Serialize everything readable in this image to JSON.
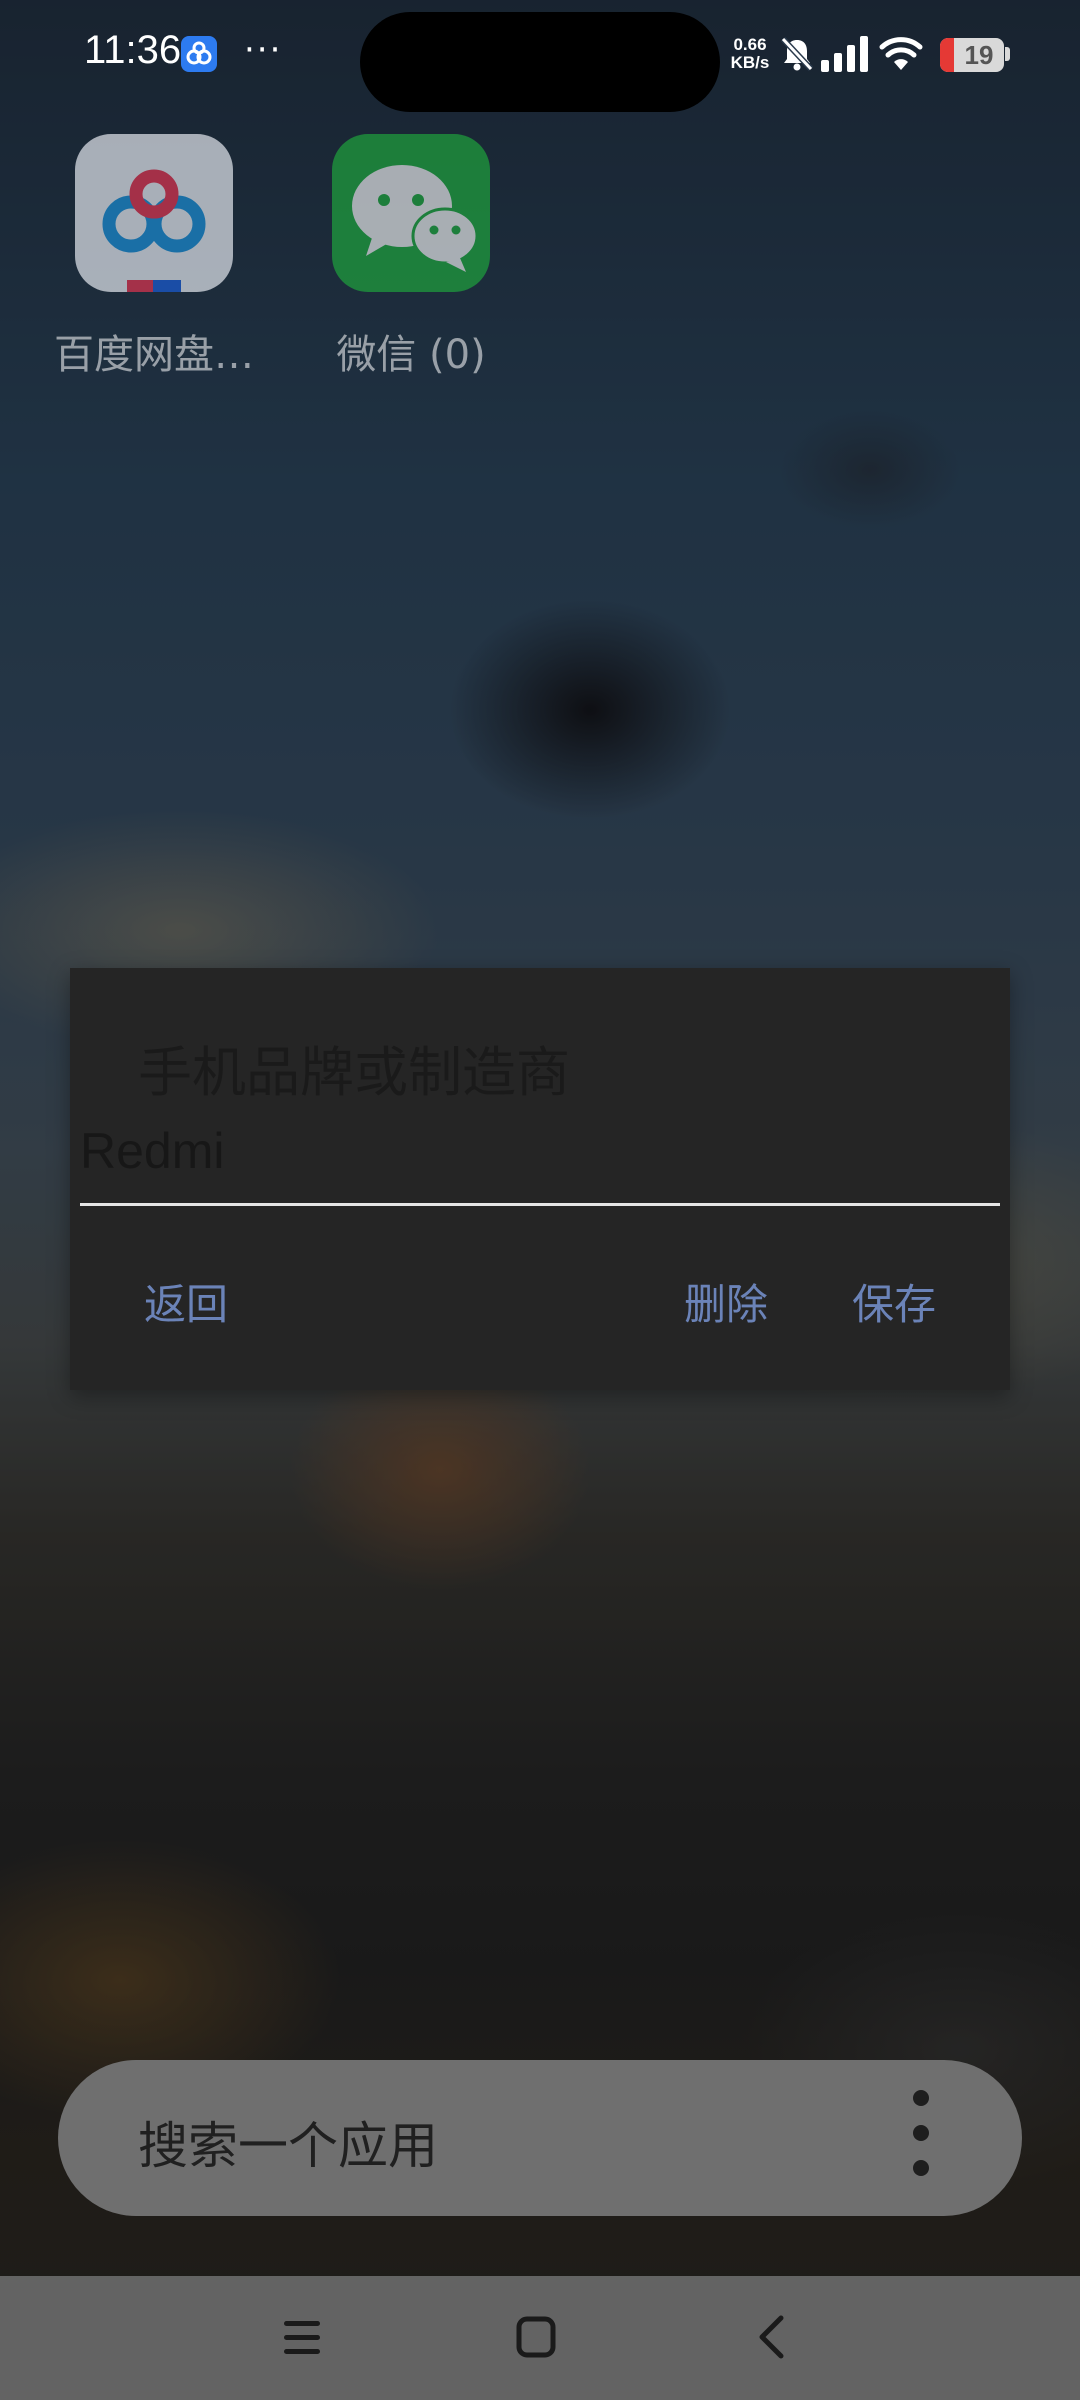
{
  "status_bar": {
    "time": "11:36",
    "more_indicator": "···",
    "net_speed_value": "0.66",
    "net_speed_unit": "KB/s",
    "battery_level": "19",
    "icons": [
      "baidu-netdisk-notification-icon",
      "silent-bell-icon",
      "signal-icon",
      "wifi-icon",
      "battery-icon"
    ]
  },
  "home": {
    "apps": [
      {
        "label": "百度网盘…",
        "icon": "baidu-netdisk-icon"
      },
      {
        "label": "微信 (0)",
        "icon": "wechat-icon"
      }
    ]
  },
  "dialog": {
    "title": "手机品牌或制造商",
    "input_value": "Redmi",
    "buttons": {
      "back": "返回",
      "delete": "删除",
      "save": "保存"
    }
  },
  "search": {
    "placeholder": "搜索一个应用",
    "menu_icon": "more-vertical-icon"
  },
  "navigation": {
    "icons": [
      "menu-icon",
      "home-icon",
      "back-icon"
    ]
  },
  "colors": {
    "dialog_background": "#252525",
    "dialog_button": "#6b83b8",
    "search_bar": "#6f6f6f",
    "nav_bar": "#636363",
    "battery_low": "#e53935"
  }
}
